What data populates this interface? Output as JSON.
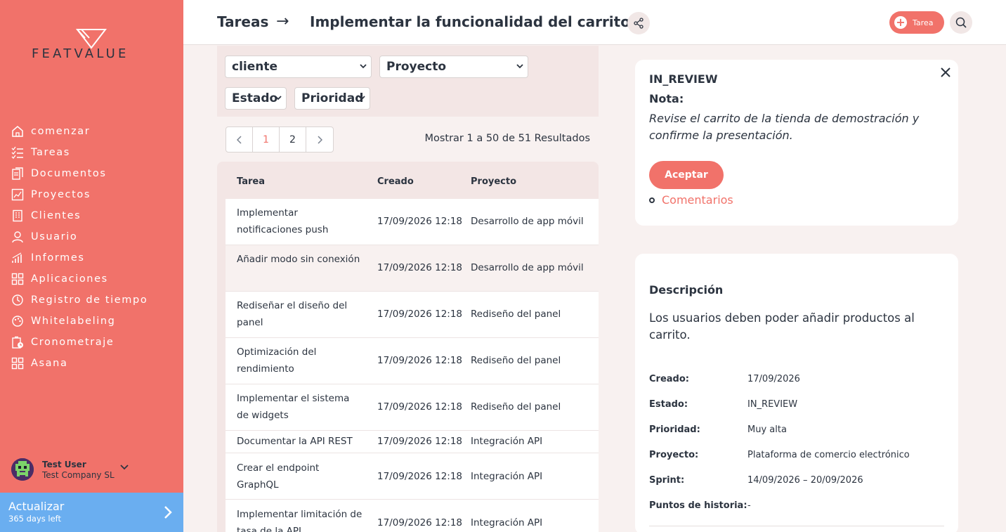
{
  "app": {
    "logo_text": "FEATVALUE"
  },
  "sidebar": {
    "items": [
      {
        "label": "comenzar",
        "icon": "home-icon"
      },
      {
        "label": "Tareas",
        "icon": "tasks-icon"
      },
      {
        "label": "Documentos",
        "icon": "documents-icon"
      },
      {
        "label": "Proyectos",
        "icon": "projects-icon"
      },
      {
        "label": "Clientes",
        "icon": "clients-icon"
      },
      {
        "label": "Usuario",
        "icon": "user-icon"
      },
      {
        "label": "Informes",
        "icon": "reports-icon"
      },
      {
        "label": "Aplicaciones",
        "icon": "apps-icon"
      },
      {
        "label": "Registro de tiempo",
        "icon": "timelog-icon"
      },
      {
        "label": "Whitelabeling",
        "icon": "whitelabel-icon"
      },
      {
        "label": "Cronometraje",
        "icon": "timer-icon"
      },
      {
        "label": "Asana",
        "icon": "asana-icon"
      }
    ],
    "user": {
      "name": "Test User",
      "company": "Test Company SL"
    },
    "upgrade": {
      "title": "Actualizar",
      "subtitle": "365 days left"
    }
  },
  "header": {
    "breadcrumb_root": "Tareas",
    "breadcrumb_arrow": "→",
    "title": "Implementar la funcionalidad del carrito",
    "task_button": "Tarea"
  },
  "filters": {
    "client": "cliente",
    "project": "Proyecto",
    "status": "Estado",
    "priority": "Prioridad"
  },
  "pagination": {
    "pages": [
      "1",
      "2"
    ],
    "current_page": "1",
    "results_text": "Mostrar 1 a 50 de 51 Resultados"
  },
  "table": {
    "columns": [
      "Tarea",
      "Creado",
      "Proyecto"
    ],
    "rows": [
      {
        "task": "Implementar notificaciones push",
        "created": "17/09/2026 12:18",
        "project": "Desarrollo de app móvil"
      },
      {
        "task": "Añadir modo sin conexión",
        "created": "17/09/2026 12:18",
        "project": "Desarrollo de app móvil"
      },
      {
        "task": "Rediseñar el diseño del panel",
        "created": "17/09/2026 12:18",
        "project": "Rediseño del panel"
      },
      {
        "task": "Optimización del rendimiento",
        "created": "17/09/2026 12:18",
        "project": "Rediseño del panel"
      },
      {
        "task": "Implementar el sistema de widgets",
        "created": "17/09/2026 12:18",
        "project": "Rediseño del panel"
      },
      {
        "task": "Documentar la API REST",
        "created": "17/09/2026 12:18",
        "project": "Integración API"
      },
      {
        "task": "Crear el endpoint GraphQL",
        "created": "17/09/2026 12:18",
        "project": "Integración API"
      },
      {
        "task": "Implementar limitación de tasa de la API",
        "created": "17/09/2026 12:18",
        "project": "Integración API"
      }
    ]
  },
  "review": {
    "status": "IN_REVIEW",
    "note_label": "Nota:",
    "note_text": "Revise el carrito de la tienda de demostración y confirme la presentación.",
    "accept_label": "Aceptar",
    "comments_label": "Comentarios"
  },
  "details": {
    "title": "Descripción",
    "description": "Los usuarios deben poder añadir productos al carrito.",
    "fields": [
      {
        "label": "Creado:",
        "value": "17/09/2026"
      },
      {
        "label": "Estado:",
        "value": "IN_REVIEW"
      },
      {
        "label": "Prioridad:",
        "value": "Muy alta"
      },
      {
        "label": "Proyecto:",
        "value": "Plataforma de comercio electrónico"
      },
      {
        "label": "Sprint:",
        "value": "14/09/2026 – 20/09/2026"
      },
      {
        "label": "Puntos de historia:",
        "value": "-"
      }
    ]
  },
  "colors": {
    "brand": "#f1726a",
    "upgrade": "#6aaef0",
    "text": "#2c3440"
  }
}
